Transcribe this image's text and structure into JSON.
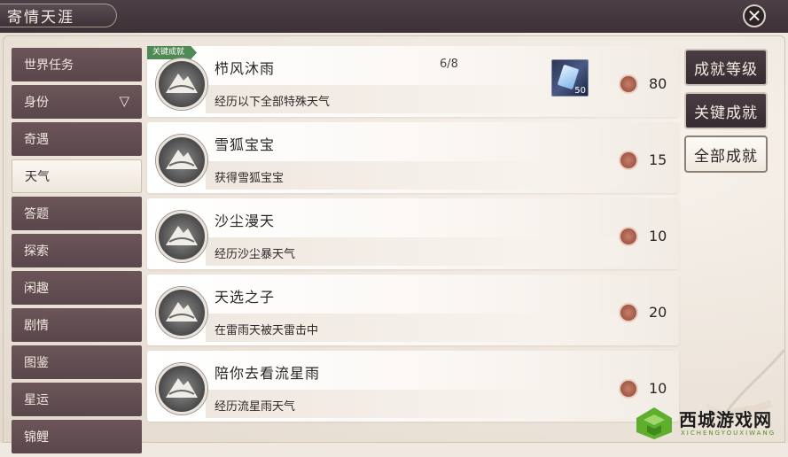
{
  "window": {
    "title": "寄情天涯",
    "close_icon": "close-icon"
  },
  "sidebar": {
    "items": [
      {
        "label": "世界任务",
        "active": false
      },
      {
        "label": "身份",
        "active": false,
        "has_chevron": true
      },
      {
        "label": "奇遇",
        "active": false
      },
      {
        "label": "天气",
        "active": true
      },
      {
        "label": "答题",
        "active": false
      },
      {
        "label": "探索",
        "active": false
      },
      {
        "label": "闲趣",
        "active": false
      },
      {
        "label": "剧情",
        "active": false
      },
      {
        "label": "图鉴",
        "active": false
      },
      {
        "label": "星运",
        "active": false
      },
      {
        "label": "锦鲤",
        "active": false
      }
    ]
  },
  "achievements": [
    {
      "badge": "关键成就",
      "name": "栉风沐雨",
      "progress": "6/8",
      "desc": "经历以下全部特殊天气",
      "reward_count": "50",
      "points": "80"
    },
    {
      "name": "雪狐宝宝",
      "desc": "获得雪狐宝宝",
      "points": "15"
    },
    {
      "name": "沙尘漫天",
      "desc": "经历沙尘暴天气",
      "points": "10"
    },
    {
      "name": "天选之子",
      "desc": "在雷雨天被天雷击中",
      "points": "20"
    },
    {
      "name": "陪你去看流星雨",
      "desc": "经历流星雨天气",
      "points": "10"
    }
  ],
  "right_buttons": {
    "level": "成就等级",
    "key": "关键成就",
    "all": "全部成就"
  },
  "watermark": {
    "title": "西城游戏网",
    "subtitle": "XICHENGYOUXIWANG"
  },
  "colors": {
    "sidebar_bg": "#5f4b4f",
    "title_bar": "#453840",
    "badge_green": "#4f8a55",
    "points_icon": "#a85e4c"
  }
}
